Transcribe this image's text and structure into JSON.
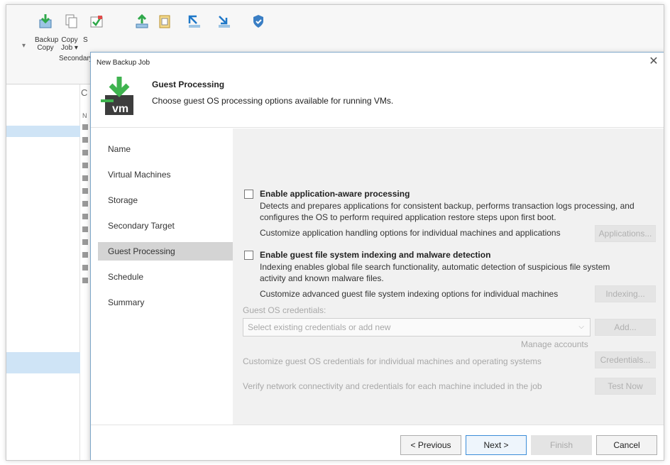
{
  "ribbon": {
    "buttons": [
      {
        "label_line1": "Backup",
        "label_line2": "Copy",
        "icon": "backup-copy-icon"
      },
      {
        "label_line1": "Copy",
        "label_line2": "Job ▾",
        "icon": "copy-job-icon"
      },
      {
        "label_line1": "S",
        "label_line2": "",
        "icon": "sure-backup-icon"
      },
      {
        "icon": "restore-icon"
      },
      {
        "icon": "clipboard-icon"
      },
      {
        "icon": "import-icon"
      },
      {
        "icon": "export-icon"
      },
      {
        "icon": "security-shield-icon"
      }
    ],
    "group_label": "Secondary"
  },
  "background": {
    "list_header": "N"
  },
  "dialog": {
    "title": "New Backup Job",
    "close_glyph": "✕",
    "header": {
      "title": "Guest Processing",
      "subtitle": "Choose guest OS processing options available for running VMs.",
      "icon": "vm-download-icon",
      "icon_text": "vm"
    },
    "steps": [
      {
        "label": "Name",
        "active": false
      },
      {
        "label": "Virtual Machines",
        "active": false
      },
      {
        "label": "Storage",
        "active": false
      },
      {
        "label": "Secondary Target",
        "active": false
      },
      {
        "label": "Guest Processing",
        "active": true
      },
      {
        "label": "Schedule",
        "active": false
      },
      {
        "label": "Summary",
        "active": false
      }
    ],
    "content": {
      "app_aware": {
        "checked": false,
        "label": "Enable application-aware processing",
        "desc_line1": "Detects and prepares applications for consistent backup, performs transaction logs processing, and",
        "desc_line2": "configures the OS to perform required application restore steps upon first boot.",
        "customize_text": "Customize application handling options for individual machines and applications",
        "button": "Applications..."
      },
      "indexing": {
        "checked": false,
        "label": "Enable guest file system indexing and malware detection",
        "desc_line1": "Indexing enables global file search functionality, automatic detection of suspicious file system",
        "desc_line2": "activity and known malware files.",
        "customize_text": "Customize advanced guest file system indexing options for individual machines",
        "button": "Indexing..."
      },
      "credentials": {
        "label": "Guest OS credentials:",
        "select_value": "Select existing credentials or add new",
        "add_button": "Add...",
        "manage_link": "Manage accounts",
        "customize_text": "Customize guest OS credentials for individual machines and operating systems",
        "credentials_button": "Credentials...",
        "verify_text": "Verify network connectivity and credentials for each machine included in the job",
        "test_button": "Test Now"
      }
    },
    "footer": {
      "previous": "< Previous",
      "next": "Next >",
      "finish": "Finish",
      "cancel": "Cancel"
    }
  }
}
